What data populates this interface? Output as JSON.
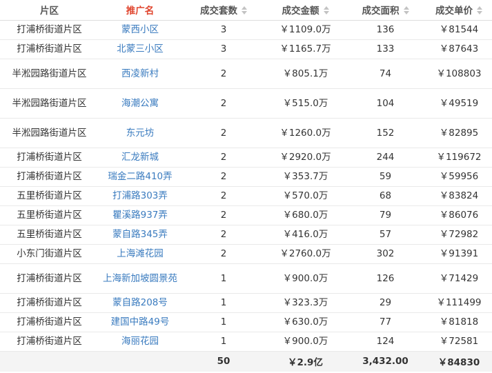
{
  "headers": [
    {
      "label": "片区",
      "sortable": false,
      "active": false
    },
    {
      "label": "推广名",
      "sortable": false,
      "active": true
    },
    {
      "label": "成交套数",
      "sortable": true,
      "active": false
    },
    {
      "label": "成交金额",
      "sortable": true,
      "active": false
    },
    {
      "label": "成交面积",
      "sortable": true,
      "active": false
    },
    {
      "label": "成交单价",
      "sortable": true,
      "active": false
    }
  ],
  "rows": [
    {
      "district": "打浦桥街道片区",
      "name": "蒙西小区",
      "count": "3",
      "amount": "￥1109.0万",
      "area": "136",
      "price": "￥81544"
    },
    {
      "district": "打浦桥街道片区",
      "name": "北蒙三小区",
      "count": "3",
      "amount": "￥1165.7万",
      "area": "133",
      "price": "￥87643"
    },
    {
      "district": "半淞园路街道片区",
      "name": "西凌新村",
      "count": "2",
      "amount": "￥805.1万",
      "area": "74",
      "price": "￥108803"
    },
    {
      "district": "半淞园路街道片区",
      "name": "海潮公寓",
      "count": "2",
      "amount": "￥515.0万",
      "area": "104",
      "price": "￥49519"
    },
    {
      "district": "半淞园路街道片区",
      "name": "东元坊",
      "count": "2",
      "amount": "￥1260.0万",
      "area": "152",
      "price": "￥82895"
    },
    {
      "district": "打浦桥街道片区",
      "name": "汇龙新城",
      "count": "2",
      "amount": "￥2920.0万",
      "area": "244",
      "price": "￥119672"
    },
    {
      "district": "打浦桥街道片区",
      "name": "瑞金二路410弄",
      "count": "2",
      "amount": "￥353.7万",
      "area": "59",
      "price": "￥59956"
    },
    {
      "district": "五里桥街道片区",
      "name": "打浦路303弄",
      "count": "2",
      "amount": "￥570.0万",
      "area": "68",
      "price": "￥83824"
    },
    {
      "district": "五里桥街道片区",
      "name": "瞿溪路937弄",
      "count": "2",
      "amount": "￥680.0万",
      "area": "79",
      "price": "￥86076"
    },
    {
      "district": "五里桥街道片区",
      "name": "蒙自路345弄",
      "count": "2",
      "amount": "￥416.0万",
      "area": "57",
      "price": "￥72982"
    },
    {
      "district": "小东门街道片区",
      "name": "上海滩花园",
      "count": "2",
      "amount": "￥2760.0万",
      "area": "302",
      "price": "￥91391"
    },
    {
      "district": "打浦桥街道片区",
      "name": "上海新加坡圆景苑",
      "count": "1",
      "amount": "￥900.0万",
      "area": "126",
      "price": "￥71429"
    },
    {
      "district": "打浦桥街道片区",
      "name": "蒙自路208号",
      "count": "1",
      "amount": "￥323.3万",
      "area": "29",
      "price": "￥111499"
    },
    {
      "district": "打浦桥街道片区",
      "name": "建国中路49号",
      "count": "1",
      "amount": "￥630.0万",
      "area": "77",
      "price": "￥81818"
    },
    {
      "district": "打浦桥街道片区",
      "name": "海丽花园",
      "count": "1",
      "amount": "￥900.0万",
      "area": "124",
      "price": "￥72581"
    }
  ],
  "totals": {
    "district": "",
    "name": "",
    "count": "50",
    "amount": "￥2.9亿",
    "area": "3,432.00",
    "price": "￥84830"
  },
  "colors": {
    "link": "#3a7bbf",
    "active_header": "#e0452e",
    "footer_bg": "#f4f4f4"
  }
}
